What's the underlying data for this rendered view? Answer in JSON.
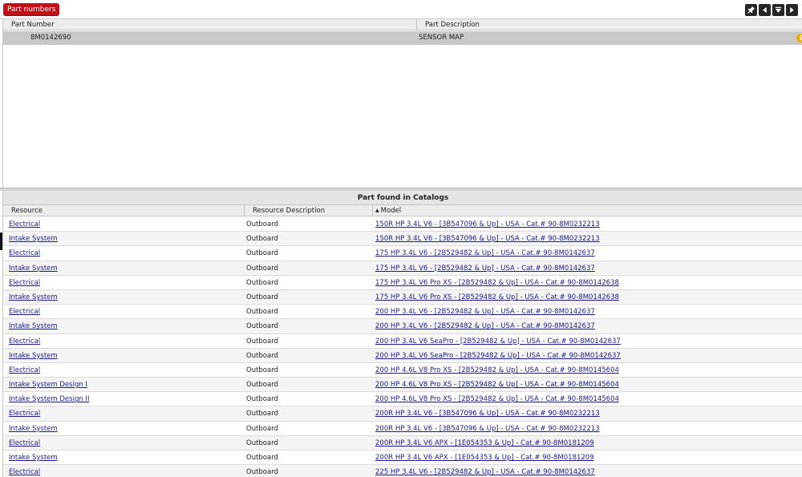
{
  "header": {
    "badge_label": "Part numbers",
    "buttons": [
      {
        "icon": "pin-icon"
      },
      {
        "icon": "previous-icon"
      },
      {
        "icon": "filter-icon"
      },
      {
        "icon": "next-icon"
      }
    ]
  },
  "parts": {
    "columns": [
      "Part Number",
      "Part Description"
    ],
    "rows": [
      {
        "number": "8M0142690",
        "description": "SENSOR MAP"
      }
    ]
  },
  "catalogs": {
    "title": "Part found in Catalogs",
    "columns": {
      "resource": "Resource",
      "resource_description": "Resource Description",
      "model": "Model",
      "model_sort": "ascending"
    },
    "rows": [
      {
        "resource": "Electrical",
        "description": "Outboard",
        "model": "150R HP 3.4L V6 - [3B547096 & Up] - USA - Cat.# 90-8M0232213"
      },
      {
        "resource": "Intake System",
        "description": "Outboard",
        "model": "150R HP 3.4L V6 - [3B547096 & Up] - USA - Cat.# 90-8M0232213"
      },
      {
        "resource": "Electrical",
        "description": "Outboard",
        "model": "175 HP 3.4L V6 - [2B529482 & Up] - USA - Cat.# 90-8M0142637"
      },
      {
        "resource": "Intake System",
        "description": "Outboard",
        "model": "175 HP 3.4L V6 - [2B529482 & Up] - USA - Cat.# 90-8M0142637"
      },
      {
        "resource": "Electrical",
        "description": "Outboard",
        "model": "175 HP 3.4L V6 Pro XS - [2B529482 & Up] - USA - Cat.# 90-8M0142638"
      },
      {
        "resource": "Intake System",
        "description": "Outboard",
        "model": "175 HP 3.4L V6 Pro XS - [2B529482 & Up] - USA - Cat.# 90-8M0142638"
      },
      {
        "resource": "Electrical",
        "description": "Outboard",
        "model": "200 HP 3.4L V6 - [2B529482 & Up] - USA - Cat.# 90-8M0142637"
      },
      {
        "resource": "Intake System",
        "description": "Outboard",
        "model": "200 HP 3.4L V6 - [2B529482 & Up] - USA - Cat.# 90-8M0142637"
      },
      {
        "resource": "Electrical",
        "description": "Outboard",
        "model": "200 HP 3.4L V6 SeaPro - [2B529482 & Up] - USA - Cat.# 90-8M0142637"
      },
      {
        "resource": "Intake System",
        "description": "Outboard",
        "model": "200 HP 3.4L V6 SeaPro - [2B529482 & Up] - USA - Cat.# 90-8M0142637"
      },
      {
        "resource": "Electrical",
        "description": "Outboard",
        "model": "200 HP 4.6L V8 Pro XS - [2B529482 & Up] - USA - Cat.# 90-8M0145604"
      },
      {
        "resource": "Intake System Design I",
        "description": "Outboard",
        "model": "200 HP 4.6L V8 Pro XS - [2B529482 & Up] - USA - Cat.# 90-8M0145604"
      },
      {
        "resource": "Intake System Design II",
        "description": "Outboard",
        "model": "200 HP 4.6L V8 Pro XS - [2B529482 & Up] - USA - Cat.# 90-8M0145604"
      },
      {
        "resource": "Electrical",
        "description": "Outboard",
        "model": "200R HP 3.4L V6 - [3B547096 & Up] - USA - Cat.# 90-8M0232213"
      },
      {
        "resource": "Intake System",
        "description": "Outboard",
        "model": "200R HP 3.4L V6 - [3B547096 & Up] - USA - Cat.# 90-8M0232213"
      },
      {
        "resource": "Electrical",
        "description": "Outboard",
        "model": "200R HP 3.4L V6 APX - [1E054353 & Up] - Cat.# 90-8M0181209"
      },
      {
        "resource": "Intake System",
        "description": "Outboard",
        "model": "200R HP 3.4L V6 APX - [1E054353 & Up] - Cat.# 90-8M0181209"
      },
      {
        "resource": "Electrical",
        "description": "Outboard",
        "model": "225 HP 3.4L V6 - [2B529482 & Up] - USA - Cat.# 90-8M0142637"
      }
    ]
  }
}
